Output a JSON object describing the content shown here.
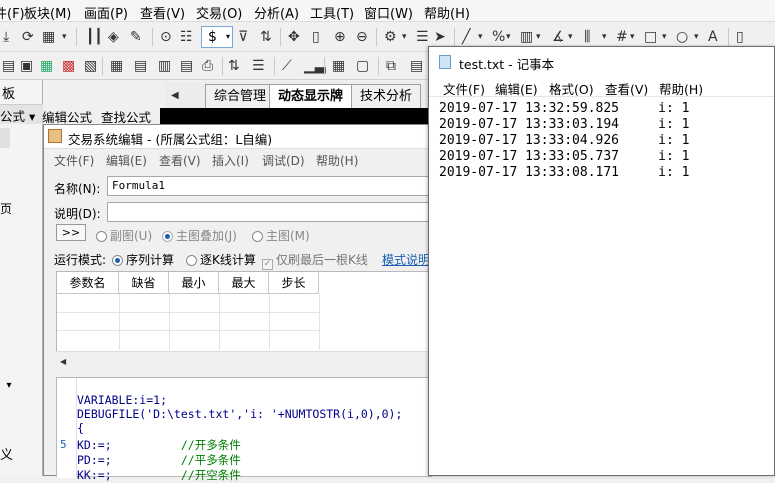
{
  "main_menu": [
    "分析(A)",
    "工具(T)",
    "窗口(W)",
    "帮助(H)"
  ],
  "main_menu_left": [
    "件(F)",
    "板块(M)",
    "画面(P)",
    "查看(V)",
    "交易(O)"
  ],
  "toolbar_dollar": "$",
  "tabs": [
    "综合管理",
    "动态显示牌",
    "技术分析"
  ],
  "left_panel": {
    "label1": "板",
    "label2": "公式 ▾",
    "label3": "页",
    "label4": "义"
  },
  "sub_header": {
    "edit": "编辑公式",
    "find": "查找公式"
  },
  "editor": {
    "title": "交易系统编辑 - (所属公式组：L自编)",
    "menu": [
      "文件(F)",
      "编辑(E)",
      "查看(V)",
      "插入(I)",
      "调试(D)",
      "帮助(H)"
    ],
    "name_label": "名称(N):",
    "name_value": "Formula1",
    "desc_label": "说明(D):",
    "expand_button": ">>",
    "radio_sub": "副图(U)",
    "radio_main_overlay": "主图叠加(J)",
    "radio_main": "主图(M)",
    "run_mode_label": "运行模式:",
    "mode_sequence": "序列计算",
    "mode_tick": "逐K线计算",
    "refresh_last": "仅刷最后一根K线",
    "mode_help": "模式说明",
    "param_headers": [
      "参数名",
      "缺省",
      "最小",
      "最大",
      "步长"
    ],
    "code_lines": [
      "VARIABLE:i=1;",
      "DEBUGFILE('D:\\test.txt','i: '+NUMTOSTR(i,0),0);",
      "{",
      "KD:=;          //开多条件",
      "PD:=;          //平多条件",
      "KK:=;          //开空条件"
    ],
    "gutter_number": "5"
  },
  "notepad": {
    "title": "test.txt - 记事本",
    "menu": [
      "文件(F)",
      "编辑(E)",
      "格式(O)",
      "查看(V)",
      "帮助(H)"
    ],
    "lines": [
      "2019-07-17 13:32:59.825     i: 1",
      "2019-07-17 13:33:03.194     i: 1",
      "2019-07-17 13:33:04.926     i: 1",
      "2019-07-17 13:33:05.737     i: 1",
      "2019-07-17 13:33:08.171     i: 1"
    ]
  },
  "colors": {
    "accent": "#1a5fb4",
    "code": "#00008b",
    "comment": "#008000",
    "string": "#a31515"
  }
}
